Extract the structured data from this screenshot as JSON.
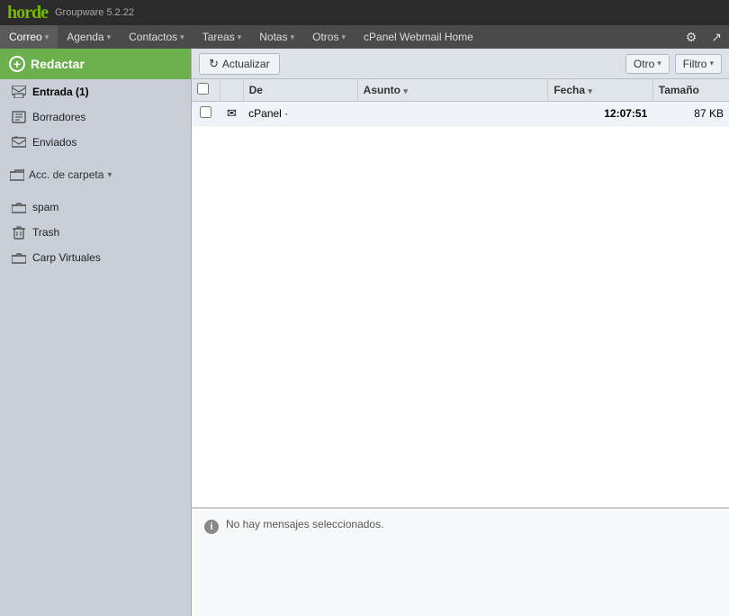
{
  "topbar": {
    "logo": "horde",
    "version": "Groupware 5.2.22"
  },
  "navbar": {
    "items": [
      {
        "id": "correo",
        "label": "Correo",
        "has_arrow": true,
        "active": true
      },
      {
        "id": "agenda",
        "label": "Agenda",
        "has_arrow": true
      },
      {
        "id": "contactos",
        "label": "Contactos",
        "has_arrow": true
      },
      {
        "id": "tareas",
        "label": "Tareas",
        "has_arrow": true
      },
      {
        "id": "notas",
        "label": "Notas",
        "has_arrow": true
      },
      {
        "id": "otros",
        "label": "Otros",
        "has_arrow": true
      },
      {
        "id": "cpanel",
        "label": "cPanel Webmail Home",
        "has_arrow": false
      }
    ],
    "settings_icon": "⚙",
    "external_icon": "↗"
  },
  "sidebar": {
    "compose_label": "Redactar",
    "items": [
      {
        "id": "entrada",
        "label": "Entrada (1)",
        "icon": "inbox",
        "active": true
      },
      {
        "id": "borradores",
        "label": "Borradores",
        "icon": "drafts"
      },
      {
        "id": "enviados",
        "label": "Enviados",
        "icon": "sent"
      },
      {
        "id": "folder_action",
        "label": "Acc. de carpeta",
        "icon": "folder",
        "has_arrow": true
      },
      {
        "id": "spam",
        "label": "spam",
        "icon": "spam"
      },
      {
        "id": "trash",
        "label": "Trash",
        "icon": "trash"
      },
      {
        "id": "carp_virtuales",
        "label": "Carp Virtuales",
        "icon": "virtual"
      }
    ]
  },
  "toolbar": {
    "refresh_label": "Actualizar",
    "other_label": "Otro",
    "filter_label": "Filtro"
  },
  "email_table": {
    "headers": {
      "checkbox": "",
      "de": "De",
      "asunto": "Asunto",
      "fecha": "Fecha",
      "tamano": "Tamaño"
    },
    "rows": [
      {
        "id": "row1",
        "checked": false,
        "has_flag": true,
        "de": "cPanel ·",
        "asunto": "",
        "fecha": "12:07:51",
        "tamano": "87 KB"
      }
    ]
  },
  "preview": {
    "message": "No hay mensajes seleccionados."
  }
}
